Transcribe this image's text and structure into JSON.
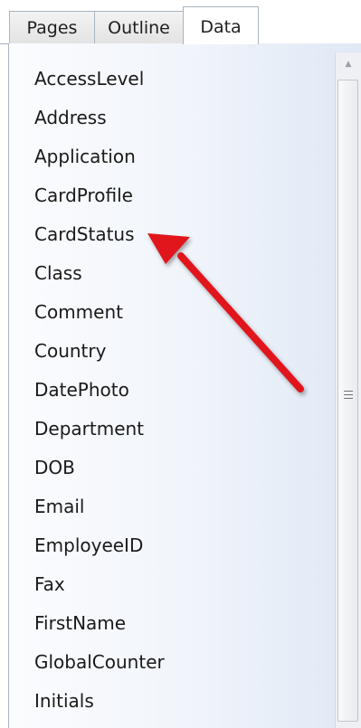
{
  "tabs": [
    {
      "label": "Pages",
      "active": false
    },
    {
      "label": "Outline",
      "active": false
    },
    {
      "label": "Data",
      "active": true
    }
  ],
  "fields": [
    "AccessLevel",
    "Address",
    "Application",
    "CardProfile",
    "CardStatus",
    "Class",
    "Comment",
    "Country",
    "DatePhoto",
    "Department",
    "DOB",
    "Email",
    "EmployeeID",
    "Fax",
    "FirstName",
    "GlobalCounter",
    "Initials"
  ],
  "annotation": {
    "points_to": "CardStatus",
    "color": "#e0141c"
  },
  "colors": {
    "panel_gradient_end": "#dfe8f5",
    "tab_border": "#a9b3c0"
  }
}
